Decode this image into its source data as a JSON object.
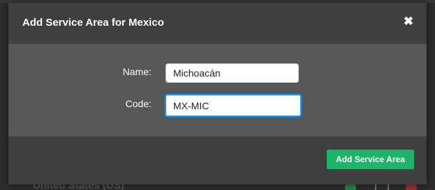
{
  "background": {
    "row_label": "United States (US)",
    "icons": [
      "add-icon",
      "edit-icon",
      "delete-icon"
    ]
  },
  "modal": {
    "title": "Add Service Area for Mexico",
    "close_icon": "✖",
    "fields": {
      "name": {
        "label": "Name:",
        "value": "Michoacán"
      },
      "code": {
        "label": "Code:",
        "value": "MX-MIC"
      }
    },
    "submit_label": "Add Service Area"
  },
  "colors": {
    "primary_button": "#1eb46a",
    "focus_border": "#2b8fd6",
    "header_bg": "#3f3f3f",
    "body_bg": "#575757"
  }
}
